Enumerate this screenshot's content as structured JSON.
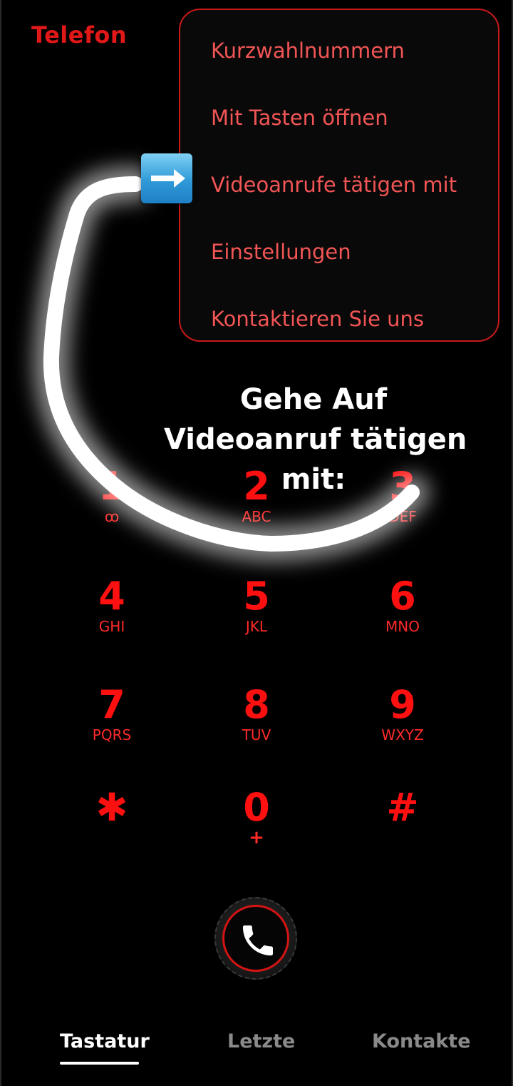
{
  "header": {
    "title": "Telefon"
  },
  "menu": {
    "items": [
      {
        "label": "Kurzwahlnummern"
      },
      {
        "label": "Mit Tasten öffnen"
      },
      {
        "label": "Videoanrufe tätigen mit"
      },
      {
        "label": "Einstellungen"
      },
      {
        "label": "Kontaktieren Sie uns"
      }
    ]
  },
  "annotation": {
    "line1": "Gehe Auf",
    "line2": "Videoanruf tätigen",
    "line3": "mit:",
    "arrow_icon": "right-arrow-icon",
    "stroke_color": "#ffffff"
  },
  "keypad": {
    "keys": [
      {
        "digit": "1",
        "letters": "ꝏ"
      },
      {
        "digit": "2",
        "letters": "ABC"
      },
      {
        "digit": "3",
        "letters": "DEF"
      },
      {
        "digit": "4",
        "letters": "GHI"
      },
      {
        "digit": "5",
        "letters": "JKL"
      },
      {
        "digit": "6",
        "letters": "MNO"
      },
      {
        "digit": "7",
        "letters": "PQRS"
      },
      {
        "digit": "8",
        "letters": "TUV"
      },
      {
        "digit": "9",
        "letters": "WXYZ"
      },
      {
        "digit": "✱",
        "letters": ""
      },
      {
        "digit": "0",
        "letters": "+"
      },
      {
        "digit": "#",
        "letters": ""
      }
    ]
  },
  "call": {
    "icon": "phone-icon"
  },
  "tabs": [
    {
      "label": "Tastatur",
      "active": true
    },
    {
      "label": "Letzte",
      "active": false
    },
    {
      "label": "Kontakte",
      "active": false
    }
  ],
  "colors": {
    "accent": "#e01818",
    "menu_text": "#f25555",
    "background": "#000000"
  }
}
